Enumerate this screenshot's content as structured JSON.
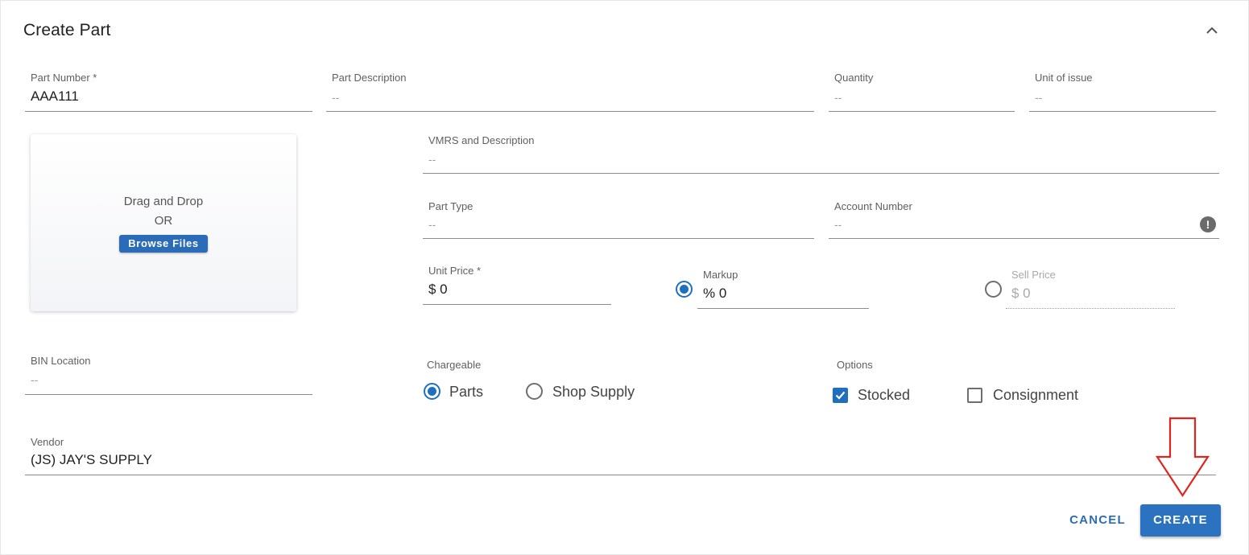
{
  "header": {
    "title": "Create Part",
    "collapse_icon": "chevron-up-icon"
  },
  "fields": {
    "part_number": {
      "label": "Part Number *",
      "value": "AAA111"
    },
    "part_description": {
      "label": "Part Description",
      "value": "--"
    },
    "quantity": {
      "label": "Quantity",
      "value": "--"
    },
    "unit_of_issue": {
      "label": "Unit of issue",
      "value": "--"
    },
    "vmrs": {
      "label": "VMRS and Description",
      "value": "--"
    },
    "part_type": {
      "label": "Part Type",
      "value": "--"
    },
    "account_number": {
      "label": "Account Number",
      "value": "--"
    },
    "unit_price": {
      "label": "Unit Price *",
      "value": "$ 0"
    },
    "markup": {
      "label": "Markup",
      "value": "% 0",
      "selected": true
    },
    "sell_price": {
      "label": "Sell Price",
      "value": "$ 0",
      "selected": false
    },
    "bin_location": {
      "label": "BIN Location",
      "value": "--"
    },
    "vendor": {
      "label": "Vendor",
      "value": "(JS) JAY'S SUPPLY"
    }
  },
  "upload": {
    "line1": "Drag and Drop",
    "line2": "OR",
    "button": "Browse Files"
  },
  "chargeable": {
    "label": "Chargeable",
    "options": [
      {
        "label": "Parts",
        "selected": true
      },
      {
        "label": "Shop Supply",
        "selected": false
      }
    ]
  },
  "options": {
    "label": "Options",
    "items": [
      {
        "label": "Stocked",
        "checked": true
      },
      {
        "label": "Consignment",
        "checked": false
      }
    ]
  },
  "info_icon_glyph": "!",
  "actions": {
    "cancel": "CANCEL",
    "create": "CREATE"
  },
  "colors": {
    "accent": "#2b72c0",
    "annotation_arrow": "#e0241f"
  }
}
